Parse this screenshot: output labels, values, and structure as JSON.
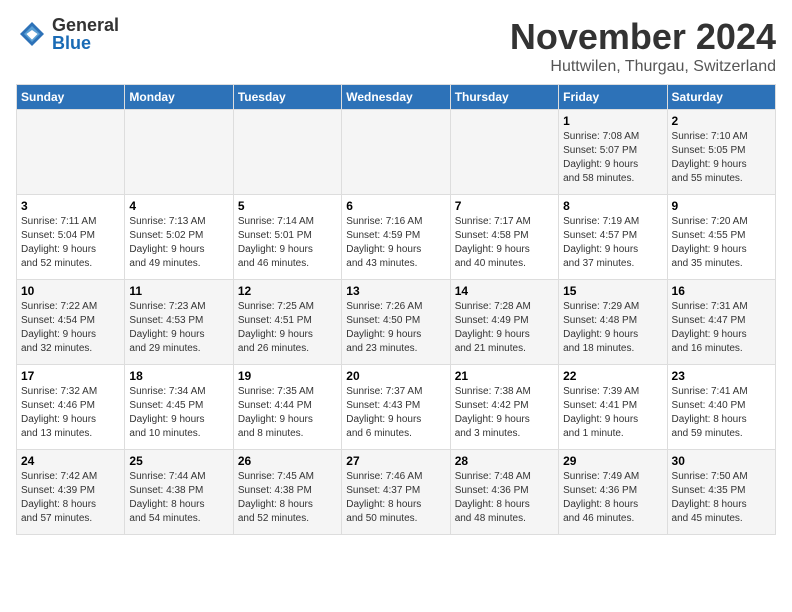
{
  "header": {
    "logo_general": "General",
    "logo_blue": "Blue",
    "month_title": "November 2024",
    "location": "Huttwilen, Thurgau, Switzerland"
  },
  "weekdays": [
    "Sunday",
    "Monday",
    "Tuesday",
    "Wednesday",
    "Thursday",
    "Friday",
    "Saturday"
  ],
  "weeks": [
    [
      {
        "day": "",
        "info": ""
      },
      {
        "day": "",
        "info": ""
      },
      {
        "day": "",
        "info": ""
      },
      {
        "day": "",
        "info": ""
      },
      {
        "day": "",
        "info": ""
      },
      {
        "day": "1",
        "info": "Sunrise: 7:08 AM\nSunset: 5:07 PM\nDaylight: 9 hours\nand 58 minutes."
      },
      {
        "day": "2",
        "info": "Sunrise: 7:10 AM\nSunset: 5:05 PM\nDaylight: 9 hours\nand 55 minutes."
      }
    ],
    [
      {
        "day": "3",
        "info": "Sunrise: 7:11 AM\nSunset: 5:04 PM\nDaylight: 9 hours\nand 52 minutes."
      },
      {
        "day": "4",
        "info": "Sunrise: 7:13 AM\nSunset: 5:02 PM\nDaylight: 9 hours\nand 49 minutes."
      },
      {
        "day": "5",
        "info": "Sunrise: 7:14 AM\nSunset: 5:01 PM\nDaylight: 9 hours\nand 46 minutes."
      },
      {
        "day": "6",
        "info": "Sunrise: 7:16 AM\nSunset: 4:59 PM\nDaylight: 9 hours\nand 43 minutes."
      },
      {
        "day": "7",
        "info": "Sunrise: 7:17 AM\nSunset: 4:58 PM\nDaylight: 9 hours\nand 40 minutes."
      },
      {
        "day": "8",
        "info": "Sunrise: 7:19 AM\nSunset: 4:57 PM\nDaylight: 9 hours\nand 37 minutes."
      },
      {
        "day": "9",
        "info": "Sunrise: 7:20 AM\nSunset: 4:55 PM\nDaylight: 9 hours\nand 35 minutes."
      }
    ],
    [
      {
        "day": "10",
        "info": "Sunrise: 7:22 AM\nSunset: 4:54 PM\nDaylight: 9 hours\nand 32 minutes."
      },
      {
        "day": "11",
        "info": "Sunrise: 7:23 AM\nSunset: 4:53 PM\nDaylight: 9 hours\nand 29 minutes."
      },
      {
        "day": "12",
        "info": "Sunrise: 7:25 AM\nSunset: 4:51 PM\nDaylight: 9 hours\nand 26 minutes."
      },
      {
        "day": "13",
        "info": "Sunrise: 7:26 AM\nSunset: 4:50 PM\nDaylight: 9 hours\nand 23 minutes."
      },
      {
        "day": "14",
        "info": "Sunrise: 7:28 AM\nSunset: 4:49 PM\nDaylight: 9 hours\nand 21 minutes."
      },
      {
        "day": "15",
        "info": "Sunrise: 7:29 AM\nSunset: 4:48 PM\nDaylight: 9 hours\nand 18 minutes."
      },
      {
        "day": "16",
        "info": "Sunrise: 7:31 AM\nSunset: 4:47 PM\nDaylight: 9 hours\nand 16 minutes."
      }
    ],
    [
      {
        "day": "17",
        "info": "Sunrise: 7:32 AM\nSunset: 4:46 PM\nDaylight: 9 hours\nand 13 minutes."
      },
      {
        "day": "18",
        "info": "Sunrise: 7:34 AM\nSunset: 4:45 PM\nDaylight: 9 hours\nand 10 minutes."
      },
      {
        "day": "19",
        "info": "Sunrise: 7:35 AM\nSunset: 4:44 PM\nDaylight: 9 hours\nand 8 minutes."
      },
      {
        "day": "20",
        "info": "Sunrise: 7:37 AM\nSunset: 4:43 PM\nDaylight: 9 hours\nand 6 minutes."
      },
      {
        "day": "21",
        "info": "Sunrise: 7:38 AM\nSunset: 4:42 PM\nDaylight: 9 hours\nand 3 minutes."
      },
      {
        "day": "22",
        "info": "Sunrise: 7:39 AM\nSunset: 4:41 PM\nDaylight: 9 hours\nand 1 minute."
      },
      {
        "day": "23",
        "info": "Sunrise: 7:41 AM\nSunset: 4:40 PM\nDaylight: 8 hours\nand 59 minutes."
      }
    ],
    [
      {
        "day": "24",
        "info": "Sunrise: 7:42 AM\nSunset: 4:39 PM\nDaylight: 8 hours\nand 57 minutes."
      },
      {
        "day": "25",
        "info": "Sunrise: 7:44 AM\nSunset: 4:38 PM\nDaylight: 8 hours\nand 54 minutes."
      },
      {
        "day": "26",
        "info": "Sunrise: 7:45 AM\nSunset: 4:38 PM\nDaylight: 8 hours\nand 52 minutes."
      },
      {
        "day": "27",
        "info": "Sunrise: 7:46 AM\nSunset: 4:37 PM\nDaylight: 8 hours\nand 50 minutes."
      },
      {
        "day": "28",
        "info": "Sunrise: 7:48 AM\nSunset: 4:36 PM\nDaylight: 8 hours\nand 48 minutes."
      },
      {
        "day": "29",
        "info": "Sunrise: 7:49 AM\nSunset: 4:36 PM\nDaylight: 8 hours\nand 46 minutes."
      },
      {
        "day": "30",
        "info": "Sunrise: 7:50 AM\nSunset: 4:35 PM\nDaylight: 8 hours\nand 45 minutes."
      }
    ]
  ]
}
